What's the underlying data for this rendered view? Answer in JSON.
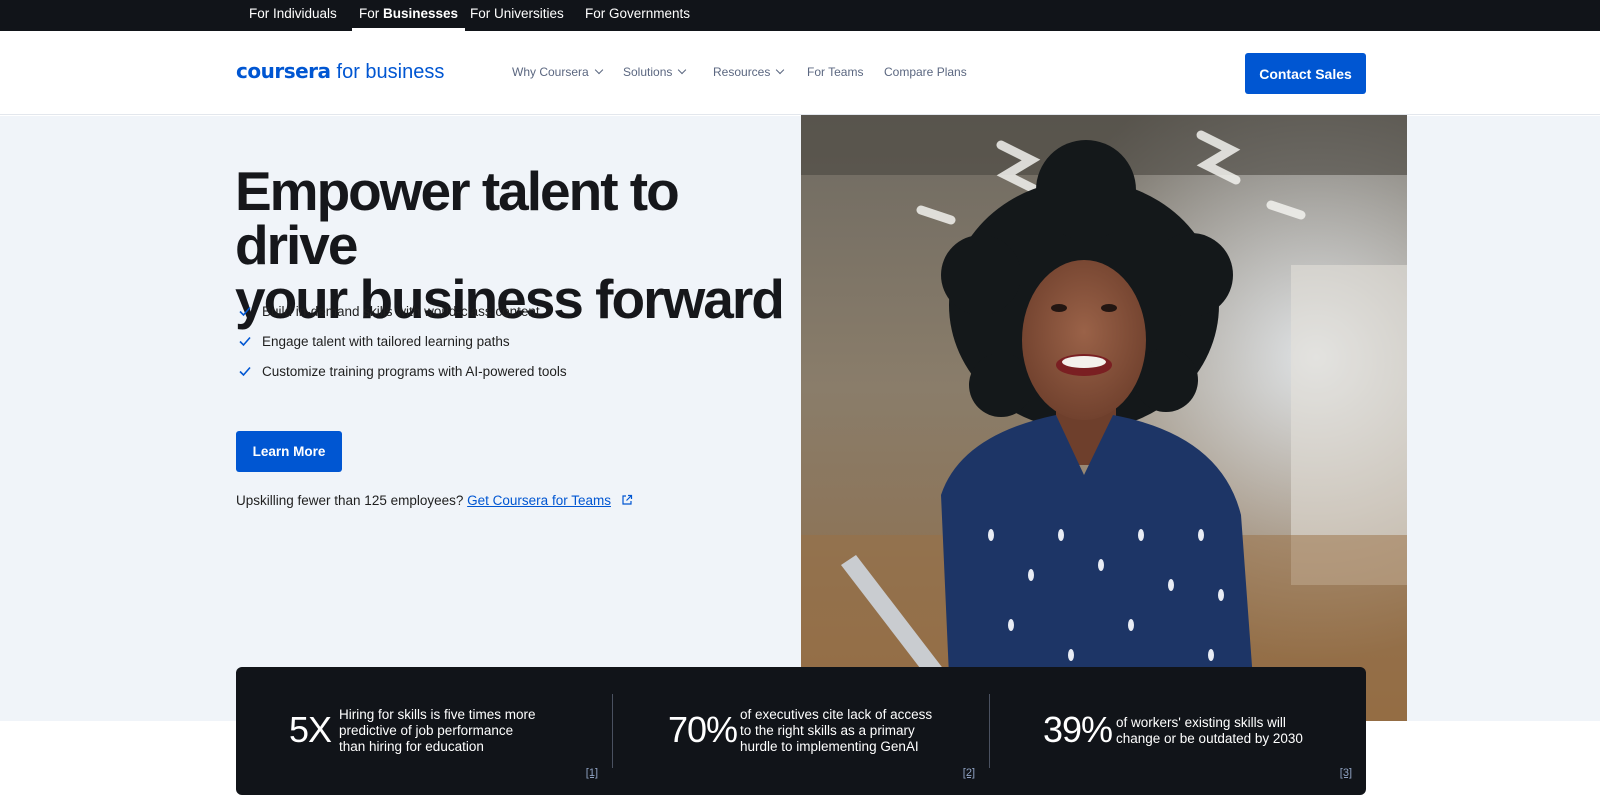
{
  "audience_bar": {
    "items": [
      {
        "prefix": "For",
        "label": "Individuals"
      },
      {
        "prefix": "For",
        "label": "Businesses",
        "active": true
      },
      {
        "prefix": "For",
        "label": "Universities"
      },
      {
        "prefix": "For",
        "label": "Governments"
      }
    ]
  },
  "header": {
    "logo_main": "coursera",
    "logo_sub": "for business",
    "nav": [
      {
        "label": "Why Coursera",
        "icon": "chevron-down-icon"
      },
      {
        "label": "Solutions",
        "icon": "chevron-down-icon"
      },
      {
        "label": "Resources",
        "icon": "chevron-down-icon"
      },
      {
        "label": "For Teams"
      },
      {
        "label": "Compare Plans"
      }
    ],
    "contact_label": "Contact Sales"
  },
  "hero": {
    "title_line1": "Empower talent to drive",
    "title_line2": "your business forward",
    "benefits": [
      "Build in-demand skills with world-class content",
      "Engage talent with tailored learning paths",
      "Customize training programs with AI-powered tools"
    ],
    "learn_more_label": "Learn More",
    "teams_prompt": "Upskilling fewer than 125 employees?",
    "teams_link": "Get Coursera for Teams"
  },
  "stats": [
    {
      "value": "5X",
      "description": "Hiring for skills is five times more predictive of job performance than hiring for education",
      "ref": "[1]"
    },
    {
      "value": "70%",
      "description": "of executives cite lack of access to the right skills as a primary hurdle to implementing GenAI",
      "ref": "[2]"
    },
    {
      "value": "39%",
      "description": "of workers' existing skills will change or be outdated by 2030",
      "ref": "[3]"
    }
  ],
  "colors": {
    "brand_blue": "#0056d2",
    "dark_band": "#111419",
    "hero_bg": "#f0f4f9"
  }
}
